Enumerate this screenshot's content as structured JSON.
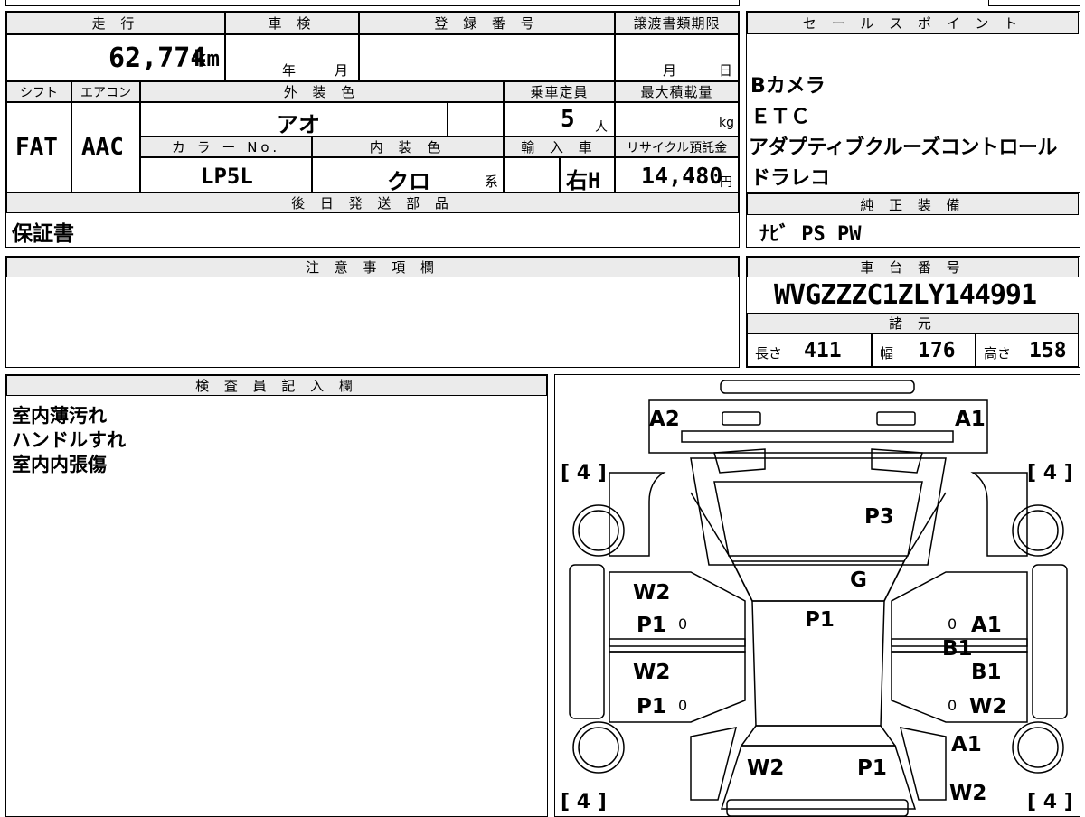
{
  "vehicle": {
    "mileage_label": "走 行",
    "mileage": "62,774",
    "mileage_unit": "km",
    "inspection_label": "車 検",
    "inspection_year_unit": "年",
    "inspection_month_unit": "月",
    "registration_label": "登 録 番 号",
    "transfer_label": "譲渡書類期限",
    "transfer_month_unit": "月",
    "transfer_day_unit": "日",
    "shift_label": "シフト",
    "shift": "FAT",
    "aircon_label": "エアコン",
    "aircon": "AAC",
    "exterior_label": "外 装 色",
    "exterior": "アオ",
    "capacity_label": "乗車定員",
    "capacity": "5",
    "capacity_unit": "人",
    "max_load_label": "最大積載量",
    "max_load_unit": "kg",
    "color_no_label": "カ ラ ー No.",
    "color_no": "LP5L",
    "interior_label": "内 装 色",
    "interior": "クロ",
    "interior_suffix": "系",
    "import_label": "輸 入 車",
    "import": "右H",
    "recycle_label": "リサイクル預託金",
    "recycle": "14,480",
    "recycle_unit": "円",
    "later_parts_label": "後 日 発 送 部 品",
    "later_parts": "保証書",
    "notes_label": "注 意 事 項 欄",
    "inspector_label": "検 査 員 記 入 欄",
    "inspector_notes": [
      "室内薄汚れ",
      "ハンドルすれ",
      "室内内張傷"
    ]
  },
  "sales": {
    "label": "セ ー ル ス ポ イ ン ト",
    "points": [
      "Bカメラ",
      "ＥＴＣ",
      "アダプティブクルーズコントロール",
      "ドラレコ"
    ]
  },
  "equipment": {
    "label": "純 正 装 備",
    "value": "ﾅﾋﾞ PS PW"
  },
  "chassis": {
    "label": "車 台 番 号",
    "value": "WVGZZZC1ZLY144991",
    "specs_label": "諸 元",
    "length_label": "長さ",
    "length": "411",
    "width_label": "幅",
    "width": "176",
    "height_label": "高さ",
    "height": "158"
  },
  "diagram": {
    "marks": {
      "a2_top": "A2",
      "a1_top": "A1",
      "tyre_fl": "4",
      "tyre_fr": "4",
      "tyre_rl": "4",
      "tyre_rr": "4",
      "p3_hood": "P3",
      "g_glass": "G",
      "w2_ld1": "W2",
      "p1_ld1": "P1",
      "zero_ld1": "0",
      "w2_ld2": "W2",
      "p1_ld2": "P1",
      "zero_ld2": "0",
      "p1_roof": "P1",
      "zero_rd1": "0",
      "a1_rd1": "A1",
      "b1_rd1": "B1",
      "b1_rd2": "B1",
      "zero_rd2": "0",
      "w2_rd2": "W2",
      "a1_rq": "A1",
      "w2_rq": "W2",
      "w2_trunk": "W2",
      "p1_trunk": "P1"
    }
  }
}
